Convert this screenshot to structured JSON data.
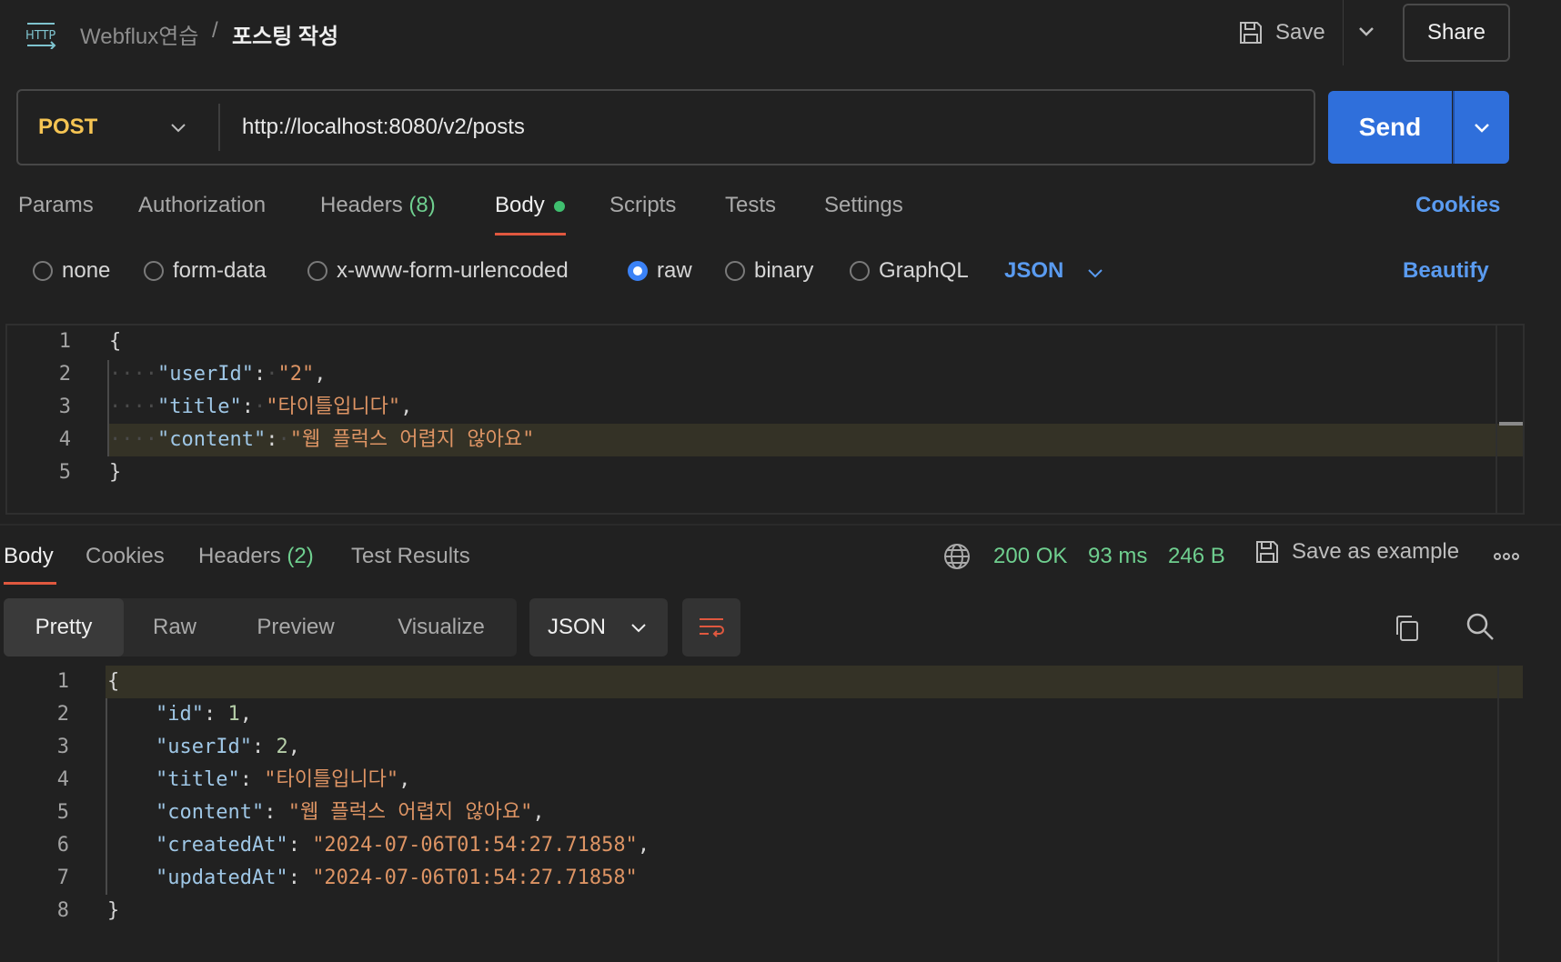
{
  "header": {
    "logo_icon": "http-icon",
    "breadcrumb_parent": "Webflux연습",
    "breadcrumb_separator": "/",
    "breadcrumb_current": "포스팅 작성",
    "save_label": "Save",
    "share_label": "Share"
  },
  "request": {
    "method": "POST",
    "url": "http://localhost:8080/v2/posts",
    "send_label": "Send",
    "tabs": [
      {
        "label": "Params",
        "count": ""
      },
      {
        "label": "Authorization",
        "count": ""
      },
      {
        "label": "Headers",
        "count": "(8)"
      },
      {
        "label": "Body",
        "count": ""
      },
      {
        "label": "Scripts",
        "count": ""
      },
      {
        "label": "Tests",
        "count": ""
      },
      {
        "label": "Settings",
        "count": ""
      }
    ],
    "active_tab": "Body",
    "cookies_label": "Cookies",
    "body_types": [
      "none",
      "form-data",
      "x-www-form-urlencoded",
      "raw",
      "binary",
      "GraphQL"
    ],
    "selected_body_type": "raw",
    "format": "JSON",
    "beautify_label": "Beautify",
    "body_lines": [
      "1",
      "2",
      "3",
      "4",
      "5"
    ],
    "body": {
      "open": "{",
      "close": "}",
      "userId_key": "\"userId\"",
      "userId_val": "\"2\"",
      "title_key": "\"title\"",
      "title_val": "\"타이틀입니다\"",
      "content_key": "\"content\"",
      "content_val": "\"웹 플럭스 어렵지 않아요\""
    }
  },
  "response": {
    "tabs": [
      {
        "label": "Body",
        "count": ""
      },
      {
        "label": "Cookies",
        "count": ""
      },
      {
        "label": "Headers",
        "count": "(2)"
      },
      {
        "label": "Test Results",
        "count": ""
      }
    ],
    "active_tab": "Body",
    "status": "200 OK",
    "time": "93 ms",
    "size": "246 B",
    "save_example_label": "Save as example",
    "views": [
      "Pretty",
      "Raw",
      "Preview",
      "Visualize"
    ],
    "active_view": "Pretty",
    "format": "JSON",
    "body_lines": [
      "1",
      "2",
      "3",
      "4",
      "5",
      "6",
      "7",
      "8"
    ],
    "body": {
      "open": "{",
      "close": "}",
      "id_key": "\"id\"",
      "id_val": "1",
      "userId_key": "\"userId\"",
      "userId_val": "2",
      "title_key": "\"title\"",
      "title_val": "\"타이틀입니다\"",
      "content_key": "\"content\"",
      "content_val": "\"웹 플럭스 어렵지 않아요\"",
      "createdAt_key": "\"createdAt\"",
      "createdAt_val": "\"2024-07-06T01:54:27.71858\"",
      "updatedAt_key": "\"updatedAt\"",
      "updatedAt_val": "\"2024-07-06T01:54:27.71858\""
    }
  },
  "colors": {
    "accent_blue": "#2f6fdb",
    "link_blue": "#5a9bf0",
    "status_green": "#6fcf8f",
    "tab_underline": "#e0583f",
    "method_yellow": "#f5c453"
  }
}
